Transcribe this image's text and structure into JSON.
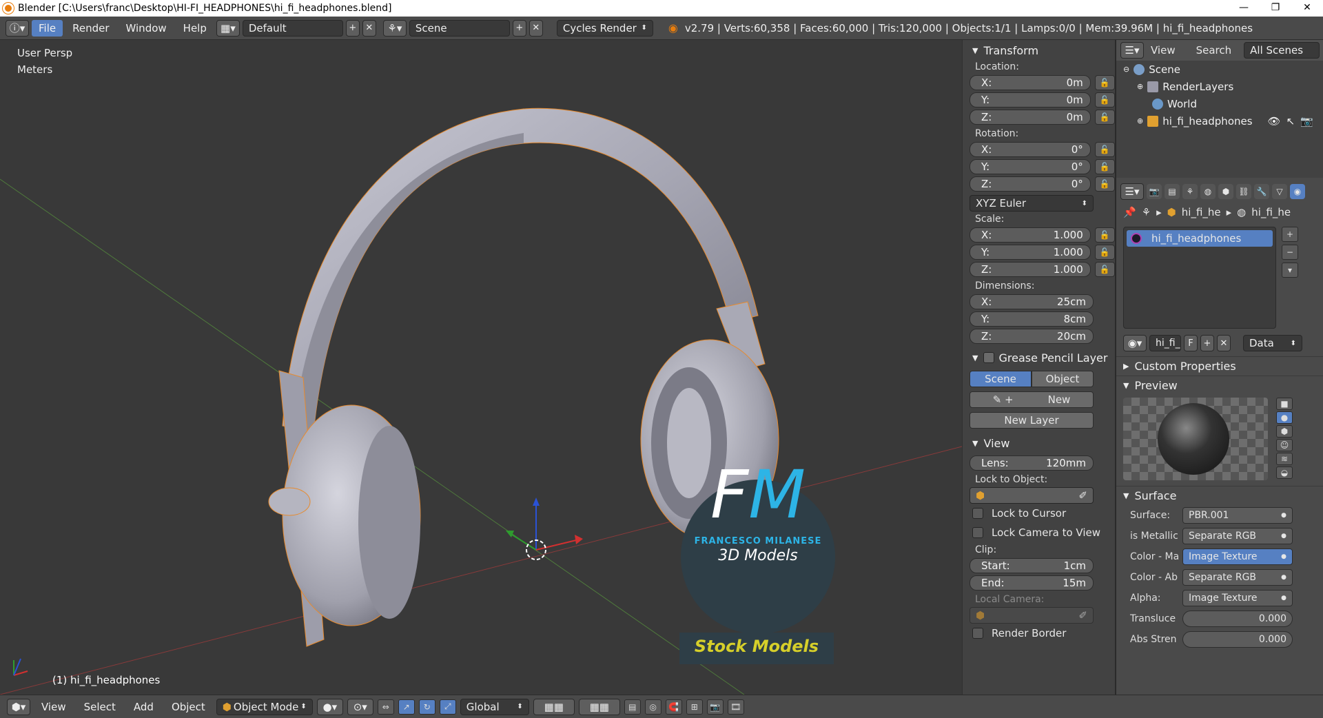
{
  "window": {
    "title": "Blender [C:\\Users\\franc\\Desktop\\HI-FI_HEADPHONES\\hi_fi_headphones.blend]",
    "controls": [
      "—",
      "❐",
      "✕"
    ]
  },
  "topbar": {
    "menus": [
      "File",
      "Render",
      "Window",
      "Help"
    ],
    "active_menu": "File",
    "layout": "Default",
    "scene": "Scene",
    "engine": "Cycles Render",
    "stats": "v2.79 | Verts:60,358 | Faces:60,000 | Tris:120,000 | Objects:1/1 | Lamps:0/0 | Mem:39.96M | hi_fi_headphones"
  },
  "viewport": {
    "view_name": "User Persp",
    "units": "Meters",
    "object_label": "(1) hi_fi_headphones",
    "watermark": {
      "monogram": "FM",
      "author": "FRANCESCO MILANESE",
      "subtitle": "3D Models",
      "banner": "Stock Models",
      "colors": {
        "monogram_f": "#ffffff",
        "monogram_m": "#2db4e6",
        "banner_text": "#d6cf2a",
        "circle": "#2e3e47"
      }
    }
  },
  "npanel": {
    "transform_title": "Transform",
    "location_label": "Location:",
    "location": [
      {
        "axis": "X:",
        "value": "0m"
      },
      {
        "axis": "Y:",
        "value": "0m"
      },
      {
        "axis": "Z:",
        "value": "0m"
      }
    ],
    "rotation_label": "Rotation:",
    "rotation": [
      {
        "axis": "X:",
        "value": "0°"
      },
      {
        "axis": "Y:",
        "value": "0°"
      },
      {
        "axis": "Z:",
        "value": "0°"
      }
    ],
    "rotation_mode": "XYZ Euler",
    "scale_label": "Scale:",
    "scale": [
      {
        "axis": "X:",
        "value": "1.000"
      },
      {
        "axis": "Y:",
        "value": "1.000"
      },
      {
        "axis": "Z:",
        "value": "1.000"
      }
    ],
    "dimensions_label": "Dimensions:",
    "dimensions": [
      {
        "axis": "X:",
        "value": "25cm"
      },
      {
        "axis": "Y:",
        "value": "8cm"
      },
      {
        "axis": "Z:",
        "value": "20cm"
      }
    ],
    "grease_title": "Grease Pencil Layer",
    "grease_scene": "Scene",
    "grease_object": "Object",
    "grease_new": "New",
    "grease_new_layer": "New Layer",
    "view_title": "View",
    "lens_label": "Lens:",
    "lens_value": "120mm",
    "lock_object_label": "Lock to Object:",
    "lock_cursor": "Lock to Cursor",
    "lock_camera": "Lock Camera to View",
    "clip_label": "Clip:",
    "clip_start_label": "Start:",
    "clip_start": "1cm",
    "clip_end_label": "End:",
    "clip_end": "15m",
    "local_camera": "Local Camera:",
    "render_border": "Render Border"
  },
  "outliner": {
    "view": "View",
    "search": "Search",
    "filter": "All Scenes",
    "items": [
      {
        "name": "Scene",
        "indent": 0
      },
      {
        "name": "RenderLayers",
        "indent": 1
      },
      {
        "name": "World",
        "indent": 1
      },
      {
        "name": "hi_fi_headphones",
        "indent": 1
      }
    ]
  },
  "properties": {
    "breadcrumb": [
      "hi_fi_he",
      "hi_fi_he"
    ],
    "material_slot": "hi_fi_headphones",
    "material_field": "hi_fi_",
    "material_f": "F",
    "data_select": "Data",
    "custom_props": "Custom Properties",
    "preview": "Preview",
    "surface_title": "Surface",
    "surface_rows": [
      {
        "label": "Surface:",
        "value": "PBR.001"
      },
      {
        "label": "is Metallic",
        "value": "Separate RGB"
      },
      {
        "label": "Color - Ma",
        "value": "Image Texture"
      },
      {
        "label": "Color - Ab",
        "value": "Separate RGB"
      },
      {
        "label": "Alpha:",
        "value": "Image Texture"
      },
      {
        "label": "Transluce",
        "value": "0.000"
      },
      {
        "label": "Abs Stren",
        "value": "0.000"
      }
    ]
  },
  "bottombar": {
    "menus": [
      "View",
      "Select",
      "Add",
      "Object"
    ],
    "mode": "Object Mode",
    "orientation": "Global"
  }
}
